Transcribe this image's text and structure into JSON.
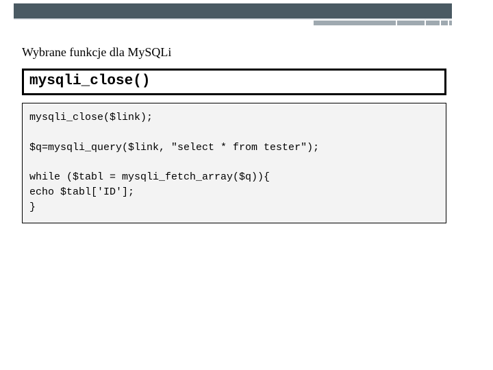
{
  "heading": "Wybrane funkcje dla MySQLi",
  "function_name": "mysqli_close()",
  "code": "mysqli_close($link);\n\n$q=mysqli_query($link, \"select * from tester\");\n\nwhile ($tabl = mysqli_fetch_array($q)){\necho $tabl['ID'];\n}"
}
